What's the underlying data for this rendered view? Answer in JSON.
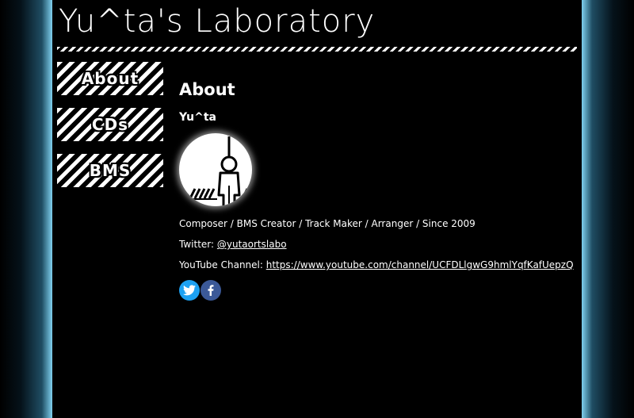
{
  "site": {
    "title": "Yu^ta's Laboratory"
  },
  "nav": {
    "items": [
      {
        "label": "About"
      },
      {
        "label": "CDs"
      },
      {
        "label": "BMS"
      }
    ]
  },
  "about": {
    "heading": "About",
    "name": "Yu^ta",
    "avatar_icon": "hanging-figure-icon",
    "roles": "Composer / BMS Creator / Track Maker / Arranger / Since 2009",
    "twitter_label": "Twitter:",
    "twitter_handle": "@yutaortslabo",
    "youtube_label": "YouTube Channel:",
    "youtube_url": "https://www.youtube.com/channel/UCFDLlgwG9hmlYqfKafUepzQ"
  },
  "social": {
    "icons": [
      "twitter-icon",
      "facebook-icon"
    ],
    "colors": {
      "twitter": "#1da1f2",
      "facebook": "#3b5998"
    }
  },
  "theme": {
    "background": "#000000",
    "glow": "#7fd0ee",
    "text": "#ffffff"
  }
}
